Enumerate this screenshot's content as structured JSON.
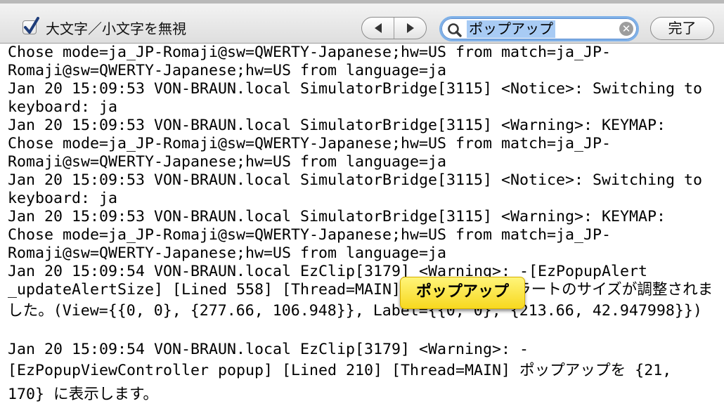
{
  "findbar": {
    "case_insensitive_label": "大文字／小文字を無視",
    "case_insensitive_checked": true,
    "search_value": "ポップアップ",
    "done_label": "完了"
  },
  "log_lines": [
    "Chose mode=ja_JP-Romaji@sw=QWERTY-Japanese;hw=US from match=ja_JP-",
    "Romaji@sw=QWERTY-Japanese;hw=US from language=ja",
    "Jan 20 15:09:53 VON-BRAUN.local SimulatorBridge[3115] <Notice>: Switching to",
    "keyboard: ja",
    "Jan 20 15:09:53 VON-BRAUN.local SimulatorBridge[3115] <Warning>: KEYMAP:",
    "Chose mode=ja_JP-Romaji@sw=QWERTY-Japanese;hw=US from match=ja_JP-",
    "Romaji@sw=QWERTY-Japanese;hw=US from language=ja",
    "Jan 20 15:09:53 VON-BRAUN.local SimulatorBridge[3115] <Notice>: Switching to",
    "keyboard: ja",
    "Jan 20 15:09:53 VON-BRAUN.local SimulatorBridge[3115] <Warning>: KEYMAP:",
    "Chose mode=ja_JP-Romaji@sw=QWERTY-Japanese;hw=US from match=ja_JP-",
    "Romaji@sw=QWERTY-Japanese;hw=US from language=ja",
    "Jan 20 15:09:54 VON-BRAUN.local EzClip[3179] <Warning>: -[EzPopupAlert",
    "_updateAlertSize] [Lined 558] [Thread=MAIN] ポップアップアラートのサイズが調整されま",
    "した。(View={{0, 0}, {277.66, 106.948}}, Label={{0, 0}, {213.66, 42.947998}})",
    "Jan 20 15:09:54 VON-BRAUN.local EzClip[3179] <Warning>: -",
    "[EzPopupViewController popup] [Lined 210] [Thread=MAIN] ポップアップを {21,",
    "170} に表示します。"
  ],
  "highlight": {
    "text": "ポップアップ",
    "color": "#f9e24a"
  },
  "icons": {
    "back": "triangle-left-icon",
    "forward": "triangle-right-icon",
    "search": "magnifier-icon",
    "clear": "clear-x-icon",
    "check": "checkmark-icon"
  }
}
